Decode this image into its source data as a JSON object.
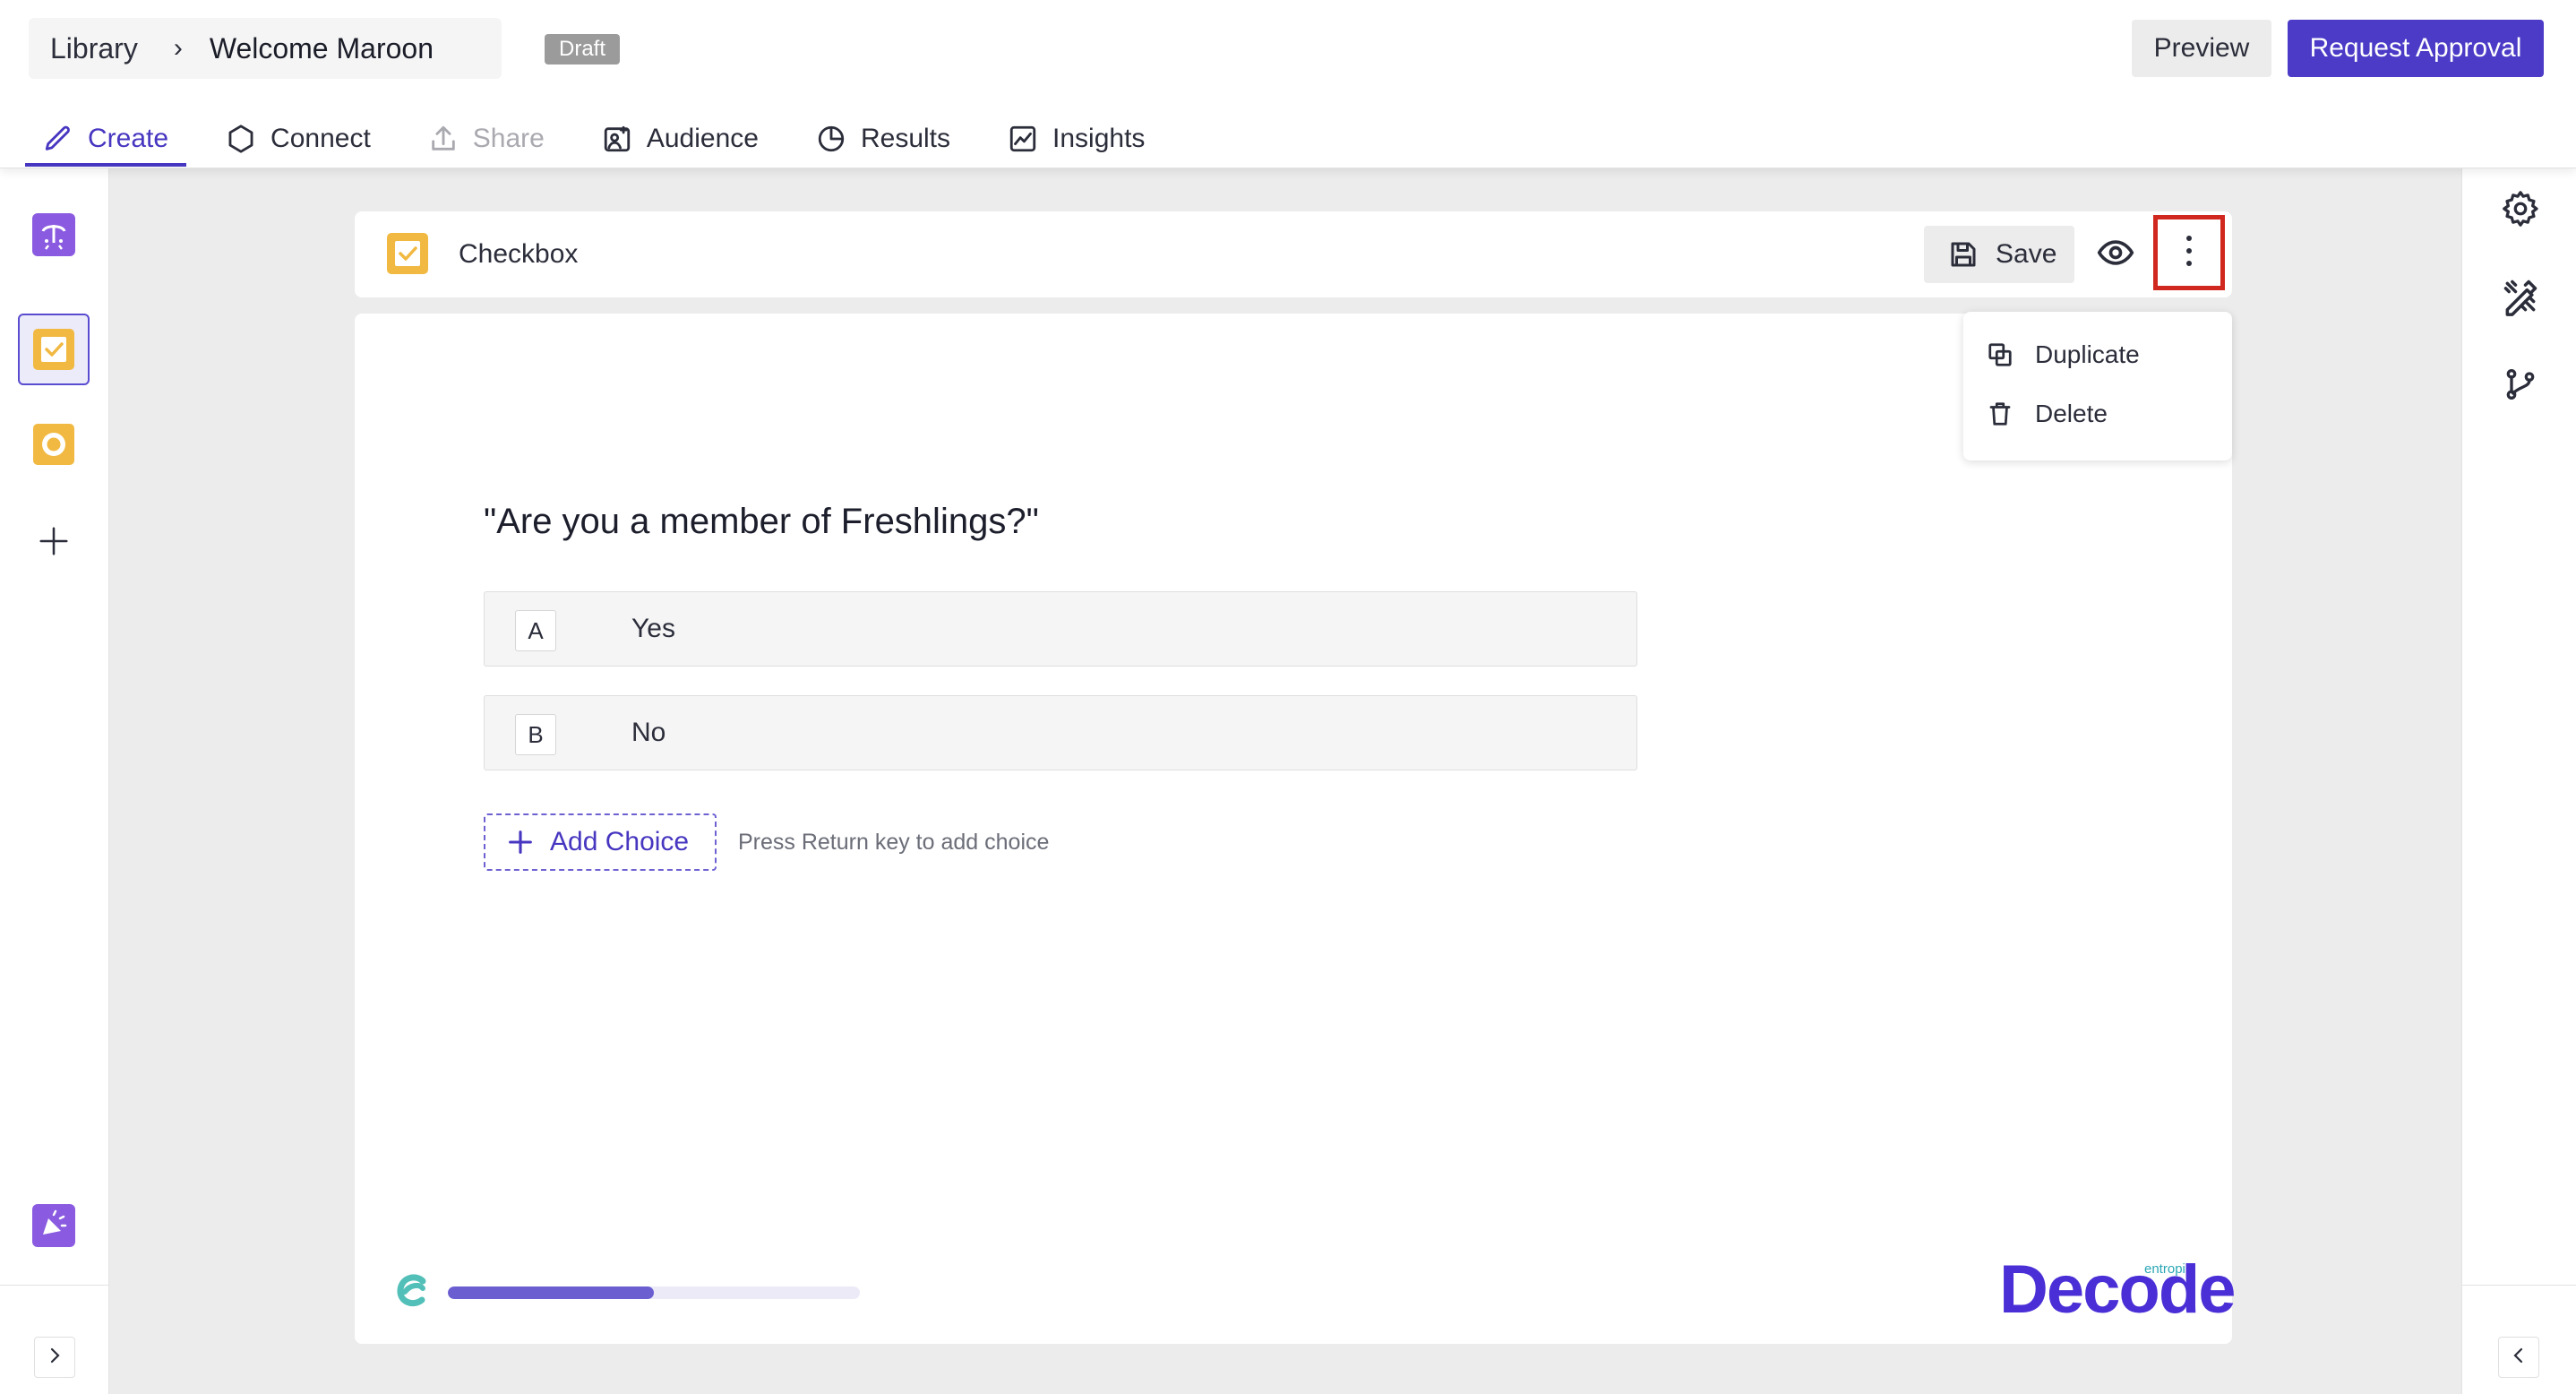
{
  "header": {
    "breadcrumb_root": "Library",
    "breadcrumb_sep": "›",
    "breadcrumb_current": "Welcome Maroon",
    "status_badge": "Draft",
    "preview_label": "Preview",
    "request_approval_label": "Request Approval",
    "accent_color": "#4b3bc7"
  },
  "tabs": [
    {
      "label": "Create",
      "icon": "pencil-icon",
      "state": "active"
    },
    {
      "label": "Connect",
      "icon": "hexagon-icon",
      "state": "normal"
    },
    {
      "label": "Share",
      "icon": "upload-icon",
      "state": "disabled"
    },
    {
      "label": "Audience",
      "icon": "audience-icon",
      "state": "normal"
    },
    {
      "label": "Results",
      "icon": "pie-chart-icon",
      "state": "normal"
    },
    {
      "label": "Insights",
      "icon": "line-chart-icon",
      "state": "normal"
    }
  ],
  "left_rail": {
    "items": [
      "welcome-block-icon",
      "checkbox-block-icon",
      "radio-block-icon",
      "add-block-icon",
      "thank-you-block-icon"
    ],
    "selected": "checkbox-block-icon",
    "toggle_icon": "chevron-right-icon"
  },
  "right_rail": {
    "items": [
      "settings-icon",
      "design-tools-icon",
      "branch-logic-icon"
    ],
    "toggle_icon": "chevron-left-icon"
  },
  "question_bar": {
    "type_label": "Checkbox",
    "type_icon": "checkbox-icon",
    "save_label": "Save",
    "preview_icon": "eye-icon",
    "more_icon": "more-vertical-icon"
  },
  "menu": {
    "items": [
      {
        "label": "Duplicate",
        "icon": "duplicate-icon"
      },
      {
        "label": "Delete",
        "icon": "trash-icon"
      }
    ]
  },
  "question": {
    "text": "\"Are you a member of Freshlings?\"",
    "choices": [
      {
        "key": "A",
        "label": "Yes"
      },
      {
        "key": "B",
        "label": "No"
      }
    ],
    "add_choice_label": "Add Choice",
    "hint": "Press Return key to add choice"
  },
  "footer": {
    "progress": 0.5,
    "brand_small": "entropik",
    "brand_big": "Decode"
  }
}
